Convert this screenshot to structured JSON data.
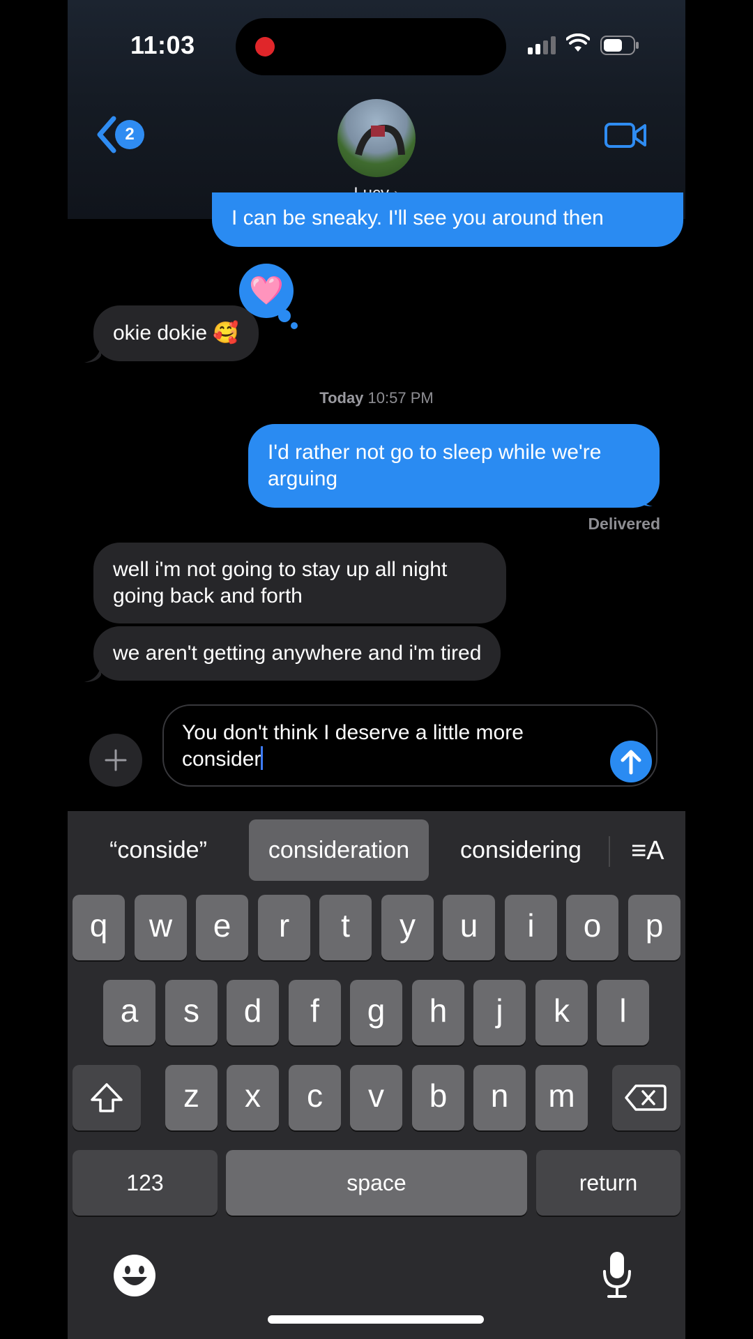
{
  "status_bar": {
    "time": "11:03"
  },
  "header": {
    "back_badge": "2",
    "contact_name": "Lucy",
    "contact_chevron": "›"
  },
  "messages": {
    "partial": "I can be sneaky. I'll see you around then",
    "okie": "okie dokie 🥰",
    "tapback": "🩷",
    "stamp_day": "Today",
    "stamp_time": "10:57 PM",
    "rather": "I'd rather not go to sleep while we're arguing",
    "delivered": "Delivered",
    "well": "well i'm not going to stay up all night going back and forth",
    "tired": "we aren't getting anywhere and i'm tired"
  },
  "compose": {
    "text": "You don't think I deserve a little more consider"
  },
  "keyboard": {
    "suggestions": [
      "“conside”",
      "consideration",
      "considering"
    ],
    "format_icon": "≡A",
    "row1": [
      "q",
      "w",
      "e",
      "r",
      "t",
      "y",
      "u",
      "i",
      "o",
      "p"
    ],
    "row2": [
      "a",
      "s",
      "d",
      "f",
      "g",
      "h",
      "j",
      "k",
      "l"
    ],
    "row3": [
      "z",
      "x",
      "c",
      "v",
      "b",
      "n",
      "m"
    ],
    "numbers": "123",
    "space": "space",
    "return": "return"
  },
  "colors": {
    "accent": "#2a8bf2",
    "incoming": "#262629",
    "keyboard_bg": "#2b2b2e"
  }
}
